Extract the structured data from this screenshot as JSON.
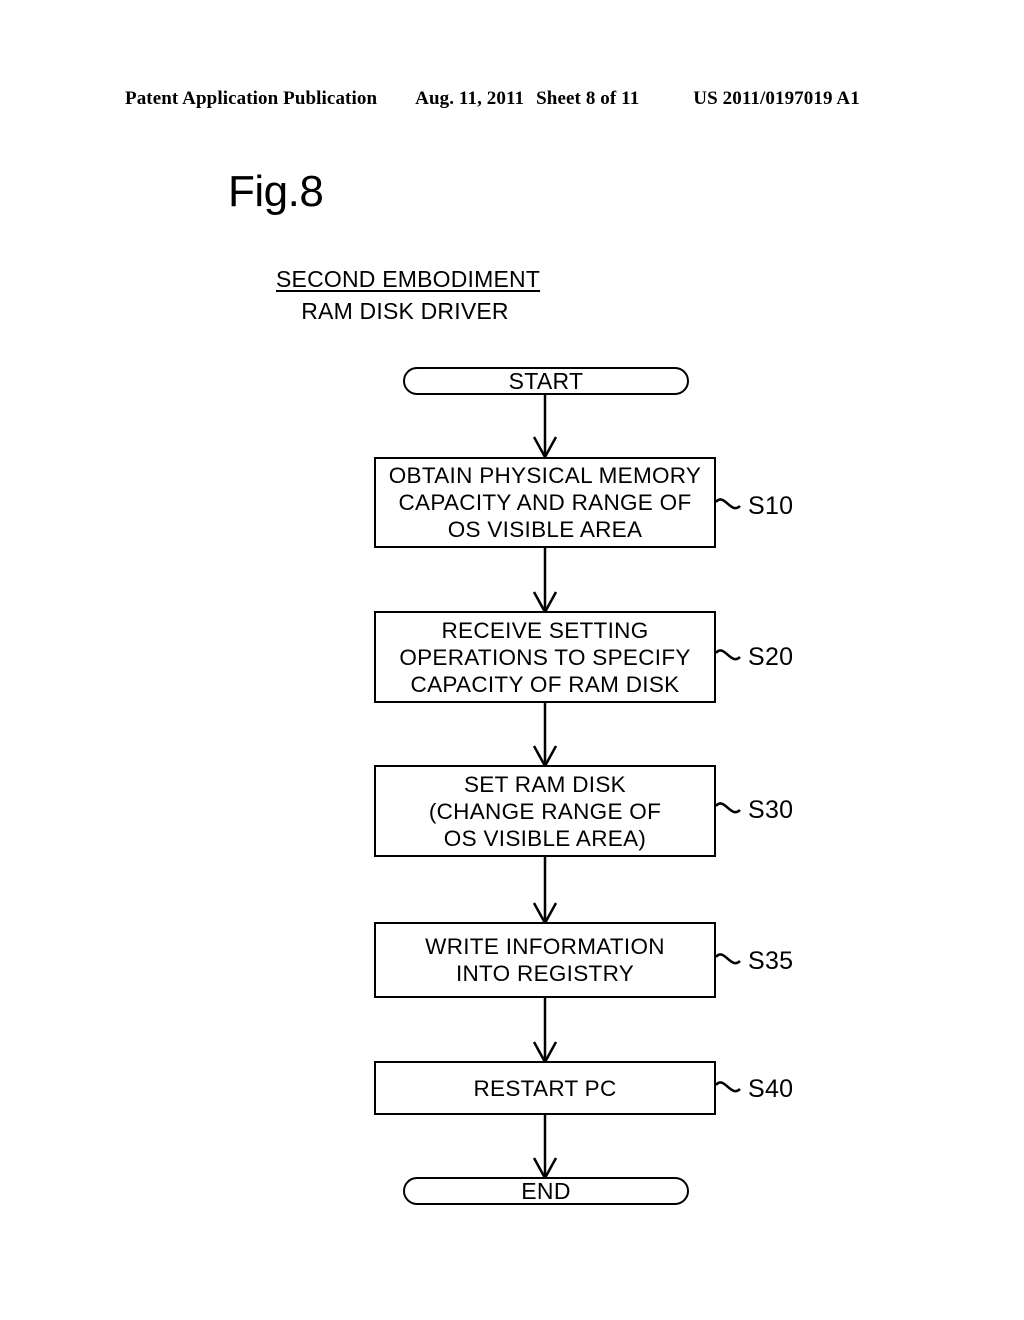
{
  "header": {
    "publication": "Patent Application Publication",
    "date": "Aug. 11, 2011",
    "sheet": "Sheet 8 of 11",
    "number": "US 2011/0197019 A1"
  },
  "figure": {
    "title": "Fig.8",
    "subtitle_line1": "SECOND EMBODIMENT",
    "subtitle_line2": "RAM DISK DRIVER"
  },
  "flowchart": {
    "type": "flowchart",
    "nodes": [
      {
        "id": "start",
        "shape": "terminator",
        "text": "START",
        "step": ""
      },
      {
        "id": "s10",
        "shape": "process",
        "text": "OBTAIN PHYSICAL MEMORY\nCAPACITY AND RANGE OF\nOS VISIBLE AREA",
        "step": "S10"
      },
      {
        "id": "s20",
        "shape": "process",
        "text": "RECEIVE SETTING\nOPERATIONS TO SPECIFY\nCAPACITY OF RAM DISK",
        "step": "S20"
      },
      {
        "id": "s30",
        "shape": "process",
        "text": "SET RAM DISK\n(CHANGE RANGE OF\nOS VISIBLE AREA)",
        "step": "S30"
      },
      {
        "id": "s35",
        "shape": "process",
        "text": "WRITE INFORMATION\nINTO REGISTRY",
        "step": "S35"
      },
      {
        "id": "s40",
        "shape": "process",
        "text": "RESTART PC",
        "step": "S40"
      },
      {
        "id": "end",
        "shape": "terminator",
        "text": "END",
        "step": ""
      }
    ],
    "edges": [
      {
        "from": "start",
        "to": "s10"
      },
      {
        "from": "s10",
        "to": "s20"
      },
      {
        "from": "s20",
        "to": "s30"
      },
      {
        "from": "s30",
        "to": "s35"
      },
      {
        "from": "s35",
        "to": "s40"
      },
      {
        "from": "s40",
        "to": "end"
      }
    ],
    "colors": {
      "stroke": "#000000",
      "fill": "#ffffff"
    }
  }
}
